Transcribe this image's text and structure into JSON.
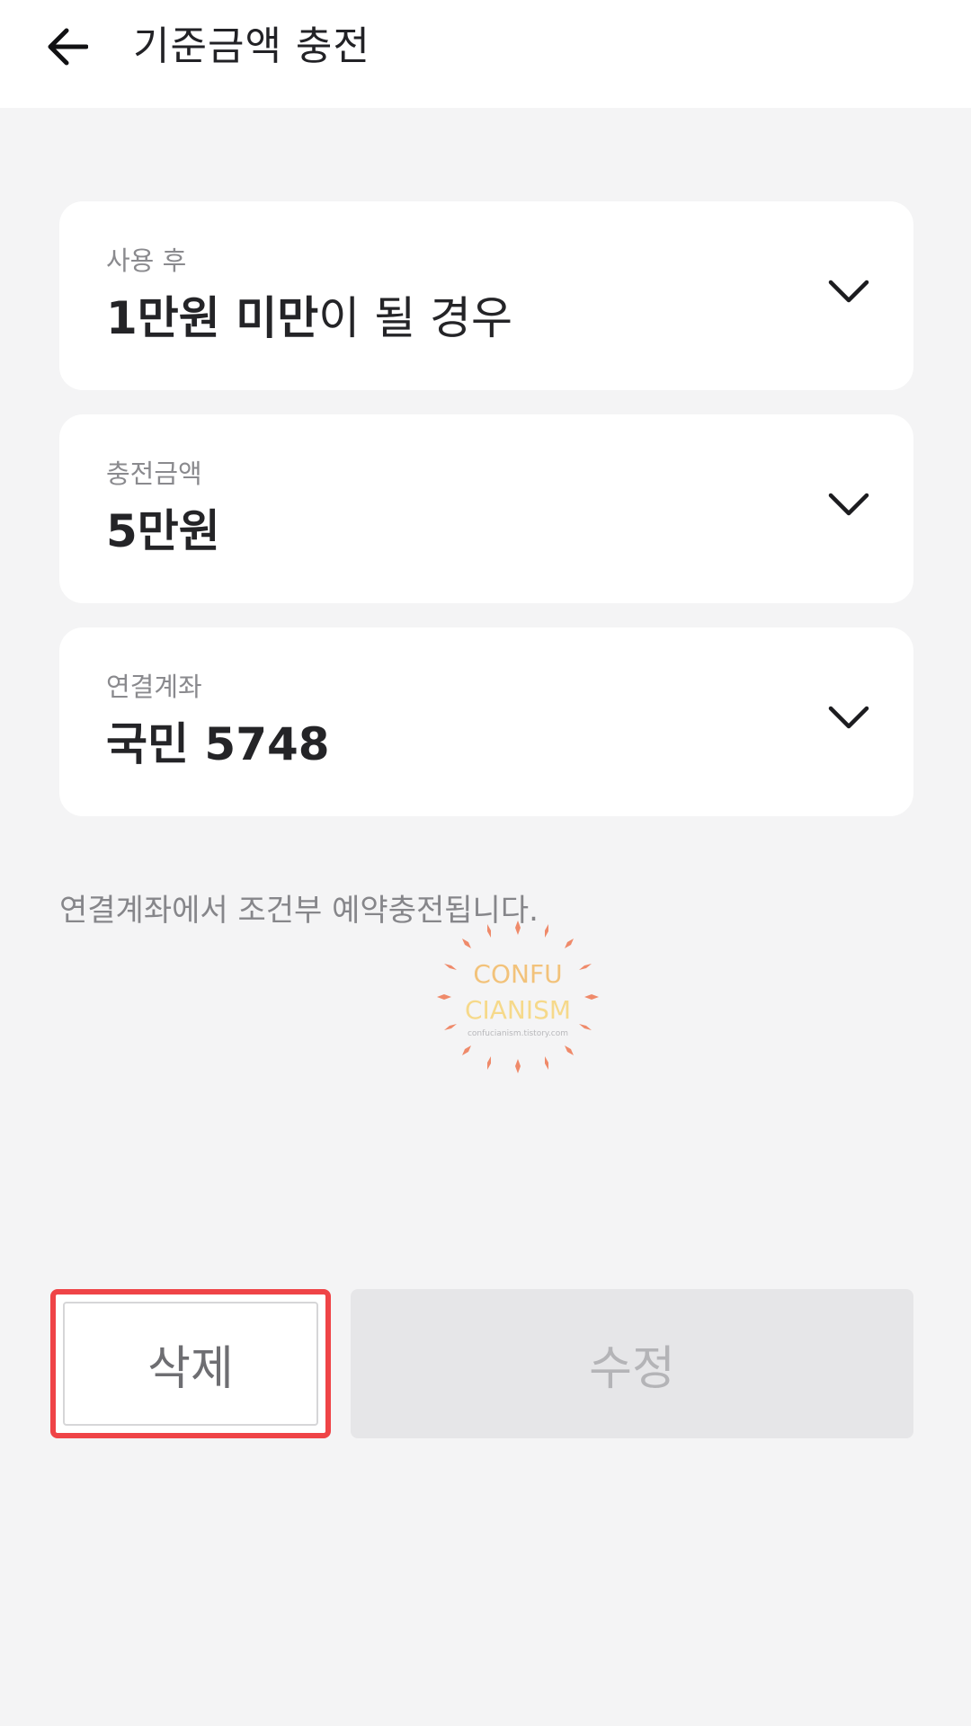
{
  "header": {
    "title": "기준금액 충전",
    "back_icon": "arrow-left-icon"
  },
  "cards": [
    {
      "label": "사용 후",
      "value_bold": "1만원 미만",
      "value_regular": "이 될 경우",
      "icon": "chevron-down-icon"
    },
    {
      "label": "충전금액",
      "value_bold": "5만원",
      "value_regular": "",
      "icon": "chevron-down-icon"
    },
    {
      "label": "연결계좌",
      "value_bold": "국민 5748",
      "value_regular": "",
      "icon": "chevron-down-icon"
    }
  ],
  "notice": "연결계좌에서 조건부 예약충전됩니다.",
  "watermark": {
    "line1": "CONFU",
    "line2": "CIANISM",
    "line3": "confucianism.tistory.com"
  },
  "buttons": {
    "delete_label": "삭제",
    "edit_label": "수정"
  },
  "colors": {
    "background": "#f4f4f5",
    "card": "#ffffff",
    "highlight_border": "#ef4447",
    "disabled_button": "#e6e6e8"
  }
}
